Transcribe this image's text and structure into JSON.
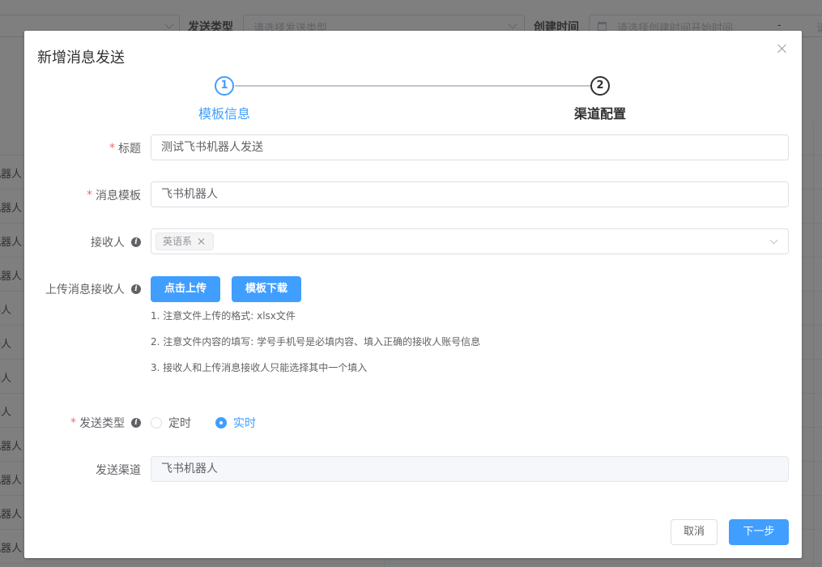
{
  "background": {
    "filter": {
      "send_type_label": "发送类型",
      "send_type_placeholder": "请选择发送类型",
      "create_time_label": "创建时间",
      "create_time_start_placeholder": "请选择创建时间开始时间",
      "range_separator": "-",
      "create_time_end_placeholder": "请"
    },
    "table_rows": [
      "机器人",
      "机器人",
      "机器人",
      "机器人",
      "器人",
      "器人",
      "器人",
      "器人",
      "机器人",
      "机器人",
      "机器人",
      "机器人"
    ]
  },
  "dialog": {
    "title": "新增消息发送",
    "steps": [
      {
        "number": "1",
        "title": "模板信息",
        "status": "active"
      },
      {
        "number": "2",
        "title": "渠道配置",
        "status": "wait"
      }
    ],
    "form": {
      "title_label": "标题",
      "title_value": "测试飞书机器人发送",
      "template_label": "消息模板",
      "template_value": "飞书机器人",
      "receiver_label": "接收人",
      "receiver_tags": [
        "英语系"
      ],
      "upload_label": "上传消息接收人",
      "upload_button": "点击上传",
      "download_button": "模板下载",
      "notes": [
        "1. 注意文件上传的格式: xlsx文件",
        "2. 注意文件内容的填写: 学号手机号是必填内容、填入正确的接收人账号信息",
        "3. 接收人和上传消息接收人只能选择其中一个填入"
      ],
      "send_type_label": "发送类型",
      "send_type_options": [
        {
          "label": "定时",
          "checked": false
        },
        {
          "label": "实时",
          "checked": true
        }
      ],
      "channel_label": "发送渠道",
      "channel_value": "飞书机器人"
    },
    "footer": {
      "cancel": "取消",
      "next": "下一步"
    }
  },
  "colors": {
    "primary": "#409eff",
    "required": "#f56c6c",
    "text": "#606266",
    "title": "#303133"
  }
}
